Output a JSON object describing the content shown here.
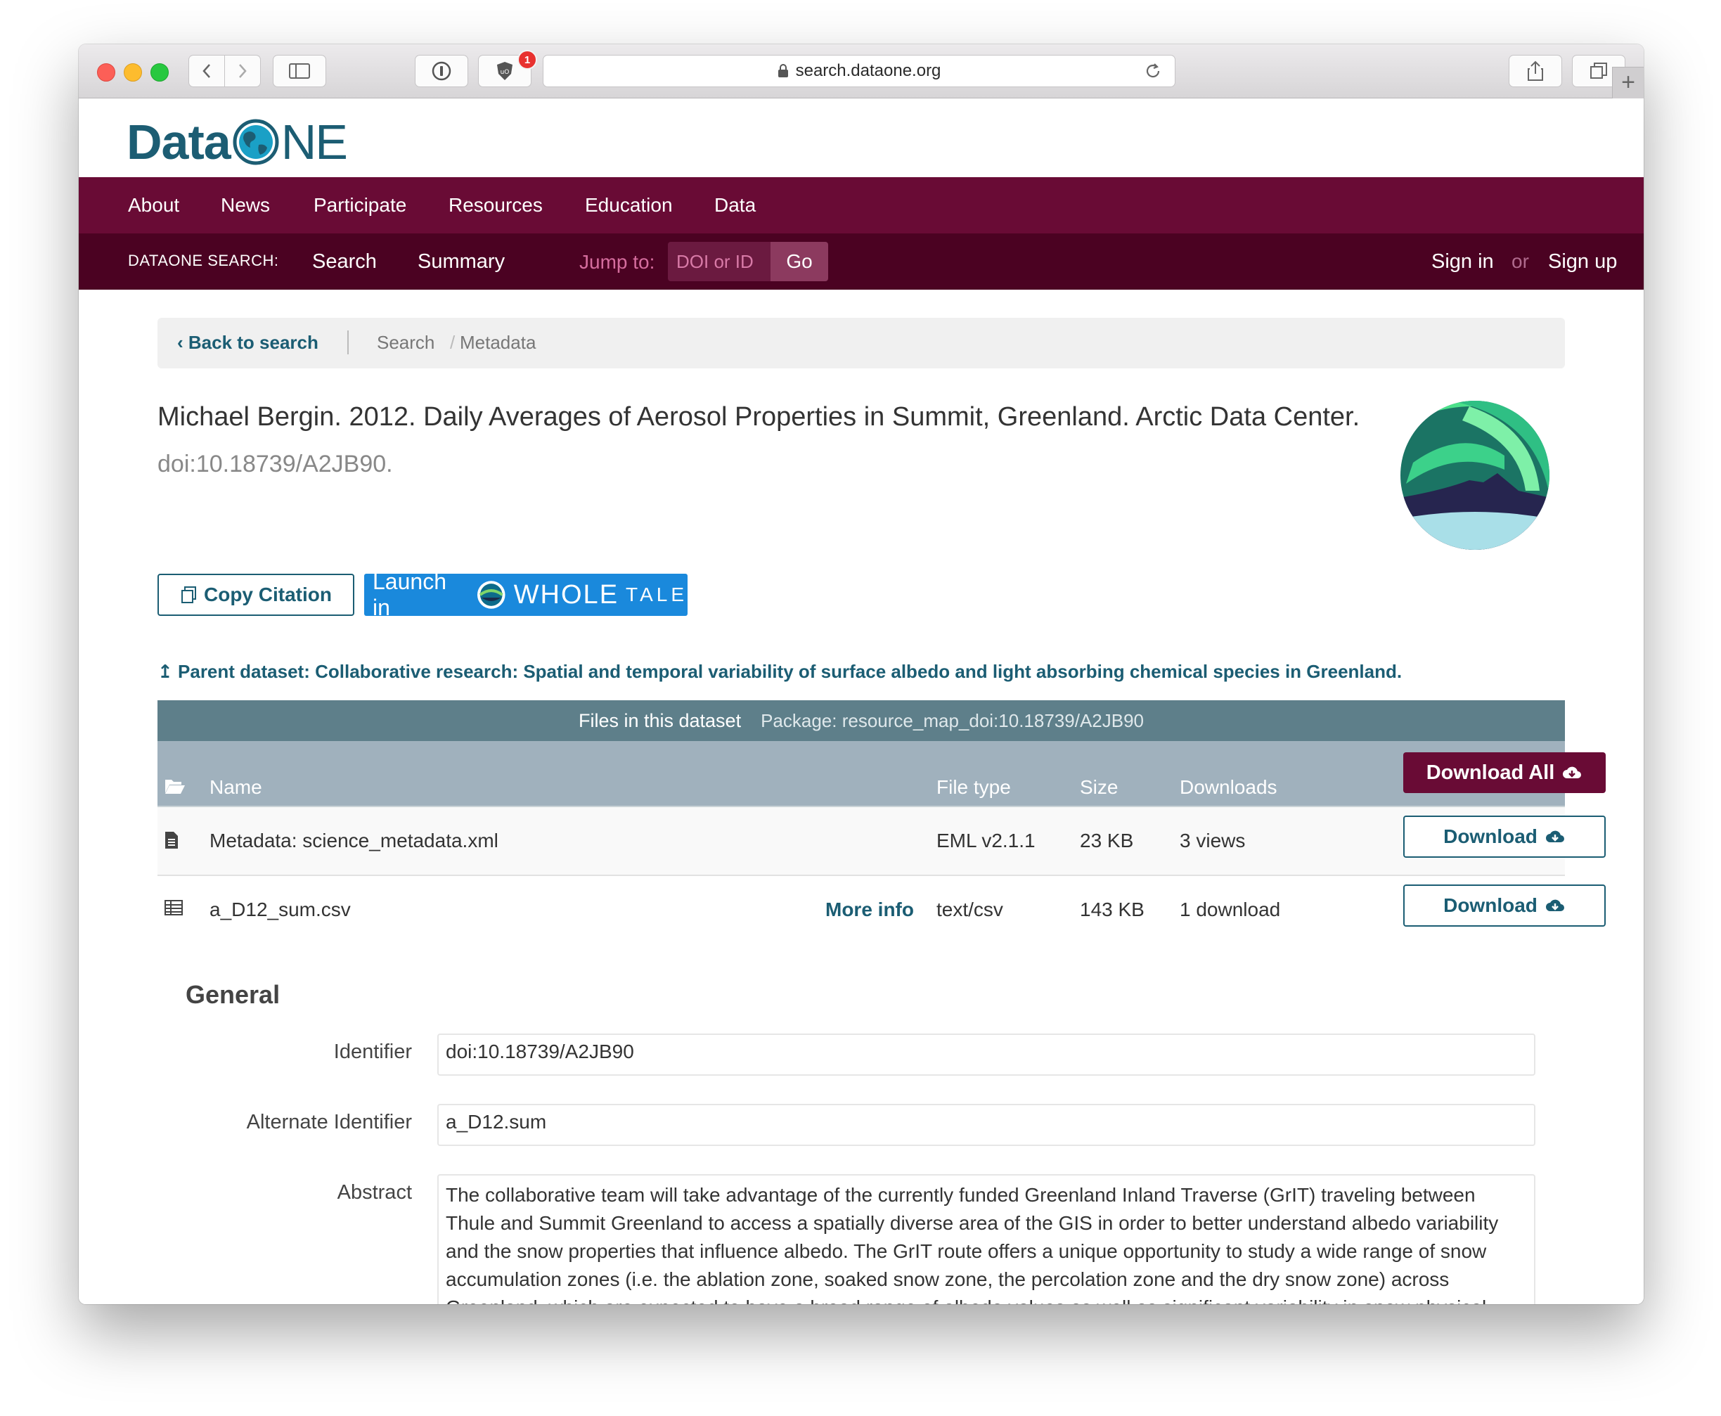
{
  "browser": {
    "url": "search.dataone.org",
    "notification_count": "1"
  },
  "logo": {
    "text_data": "Data",
    "text_one": "NE"
  },
  "nav": {
    "primary": [
      "About",
      "News",
      "Participate",
      "Resources",
      "Education",
      "Data"
    ],
    "search_label": "DATAONE SEARCH:",
    "search_link": "Search",
    "summary_link": "Summary",
    "jump_label": "Jump to:",
    "jump_placeholder": "DOI or ID",
    "go": "Go",
    "sign_in": "Sign in",
    "or": "or",
    "sign_up": "Sign up"
  },
  "breadcrumb": {
    "back": "Back to search",
    "search": "Search",
    "sep": "/",
    "current": "Metadata"
  },
  "citation": {
    "text": "Michael Bergin. 2012. Daily Averages of Aerosol Properties in Summit, Greenland. Arctic Data Center.",
    "doi": "doi:10.18739/A2JB90."
  },
  "actions": {
    "copy_citation": "Copy Citation",
    "launch_in": "Launch in",
    "whole": "WHOLE",
    "tale": "TALE"
  },
  "parent": {
    "label": "Parent dataset:",
    "title": "Collaborative research: Spatial and temporal variability of surface albedo and light absorbing chemical species in Greenland."
  },
  "files": {
    "header": "Files in this dataset",
    "package": "Package: resource_map_doi:10.18739/A2JB90",
    "columns": {
      "name": "Name",
      "type": "File type",
      "size": "Size",
      "downloads": "Downloads"
    },
    "download_all": "Download All",
    "rows": [
      {
        "name": "Metadata: science_metadata.xml",
        "more": "",
        "type": "EML v2.1.1",
        "size": "23 KB",
        "downloads": "3 views",
        "button": "Download"
      },
      {
        "name": "a_D12_sum.csv",
        "more": "More info",
        "type": "text/csv",
        "size": "143 KB",
        "downloads": "1 download",
        "button": "Download"
      }
    ]
  },
  "general": {
    "title": "General",
    "identifier_label": "Identifier",
    "identifier": "doi:10.18739/A2JB90",
    "alt_label": "Alternate Identifier",
    "alt": "a_D12.sum",
    "abstract_label": "Abstract",
    "abstract": "The collaborative team will take advantage of the currently funded Greenland Inland Traverse (GrIT) traveling between Thule and Summit Greenland to access a spatially diverse area of the GIS in order to better understand albedo variability and the snow properties that influence albedo. The GrIT route offers a unique opportunity to study a wide range of snow accumulation zones (i.e. the ablation zone, soaked snow zone, the percolation zone and the dry snow zone) across Greenland, which are expected to have a broad range of albedo values as well as significant variability in snow physical"
  },
  "colors": {
    "nav_primary": "#690b35",
    "nav_secondary": "#4b0222",
    "accent": "#1b5d73",
    "table_header": "#5e7f8a",
    "whole_tale": "#1a89dc"
  }
}
